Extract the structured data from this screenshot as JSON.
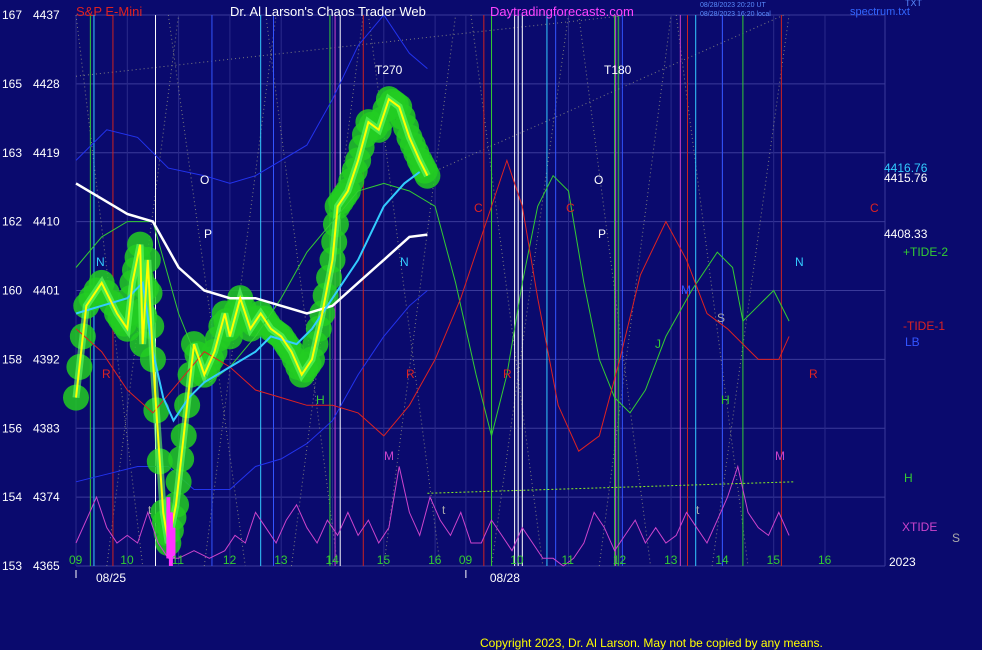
{
  "header": {
    "symbol": "S&P E-Mini",
    "title": "Dr. Al Larson's Chaos Trader Web",
    "site": "Daytradingforecasts.com",
    "stamp1": "08/28/2023 20:20 UT",
    "stamp2": "08/28/2023 16:20 local",
    "file": "spectrum.txt",
    "file_top": "TXT"
  },
  "copyright": "Copyright 2023, Dr. Al Larson. May not be copied by any means.",
  "colors": {
    "background": "#0a0a6e",
    "price_yellow": "#ffff00",
    "ma_cyan": "#33ccff",
    "ma_white": "#ffffff",
    "tide_green": "#33cc33",
    "tide_red": "#dd2222",
    "band_blue": "#2233ee",
    "xtide_magenta": "#cc44cc",
    "glow_green": "#22cc22"
  },
  "chart_data": {
    "type": "line",
    "y_axis": {
      "left_labels": [
        "167",
        "165",
        "163",
        "162",
        "160",
        "158",
        "156",
        "154",
        "153"
      ],
      "right_labels": [
        "4437",
        "4428",
        "4419",
        "4410",
        "4401",
        "4392",
        "4383",
        "4374",
        "4365"
      ],
      "range": [
        4365,
        4437
      ]
    },
    "x_axis": {
      "hour_labels_day1": [
        "09",
        "10",
        "11",
        "12",
        "13",
        "14",
        "15",
        "16"
      ],
      "hour_labels_day2": [
        "09",
        "10",
        "11",
        "12",
        "13",
        "14",
        "15",
        "16"
      ],
      "dates": [
        "08/25",
        "08/28"
      ],
      "year": "2023"
    },
    "right_legend": [
      {
        "text": "4416.76",
        "color": "#33ccff"
      },
      {
        "text": "4415.76",
        "color": "#ffffff"
      },
      {
        "text": "4408.33",
        "color": "#ffffff"
      },
      {
        "text": "+TIDE-2",
        "color": "#33cc33"
      },
      {
        "text": "-TIDE-1",
        "color": "#dd2222"
      },
      {
        "text": "LB",
        "color": "#3355ff"
      },
      {
        "text": "H",
        "color": "#33cc33"
      },
      {
        "text": "XTIDE",
        "color": "#cc44cc"
      },
      {
        "text": "S",
        "color": "#aaaaaa"
      }
    ],
    "annotations": [
      {
        "text": "T270",
        "color": "#ffffff"
      },
      {
        "text": "T180",
        "color": "#ffffff"
      },
      {
        "text": "O",
        "color": "#ffffff"
      },
      {
        "text": "P",
        "color": "#ffffff"
      },
      {
        "text": "O",
        "color": "#ffffff"
      },
      {
        "text": "P",
        "color": "#ffffff"
      },
      {
        "text": "R",
        "color": "#dd2222"
      },
      {
        "text": "R",
        "color": "#dd2222"
      },
      {
        "text": "R",
        "color": "#dd2222"
      },
      {
        "text": "R",
        "color": "#dd2222"
      },
      {
        "text": "C",
        "color": "#dd2222"
      },
      {
        "text": "C",
        "color": "#dd2222"
      },
      {
        "text": "C",
        "color": "#dd2222"
      },
      {
        "text": "N",
        "color": "#33ccff"
      },
      {
        "text": "N",
        "color": "#33ccff"
      },
      {
        "text": "N",
        "color": "#33ccff"
      },
      {
        "text": "H",
        "color": "#33cc33"
      },
      {
        "text": "H",
        "color": "#33cc33"
      },
      {
        "text": "M",
        "color": "#cc44cc"
      },
      {
        "text": "M",
        "color": "#cc44cc"
      },
      {
        "text": "S",
        "color": "#aaaaaa"
      },
      {
        "text": "J",
        "color": "#33cc33"
      },
      {
        "text": "M",
        "color": "#3355ff"
      },
      {
        "text": "t",
        "color": "#aaaaaa"
      },
      {
        "text": "t",
        "color": "#aaaaaa"
      },
      {
        "text": "t",
        "color": "#aaaaaa"
      }
    ],
    "series": [
      {
        "name": "Price",
        "color": "#ffff00",
        "points": [
          [
            9.0,
            4387
          ],
          [
            9.2,
            4399
          ],
          [
            9.5,
            4402
          ],
          [
            9.8,
            4398
          ],
          [
            10.0,
            4396
          ],
          [
            10.1,
            4402
          ],
          [
            10.25,
            4407
          ],
          [
            10.3,
            4394
          ],
          [
            10.4,
            4405
          ],
          [
            10.5,
            4392
          ],
          [
            10.7,
            4372
          ],
          [
            10.8,
            4368
          ],
          [
            10.95,
            4373
          ],
          [
            11.1,
            4382
          ],
          [
            11.3,
            4394
          ],
          [
            11.5,
            4390
          ],
          [
            11.7,
            4393
          ],
          [
            11.9,
            4398
          ],
          [
            12.0,
            4395
          ],
          [
            12.2,
            4400
          ],
          [
            12.4,
            4396
          ],
          [
            12.6,
            4398
          ],
          [
            12.8,
            4396
          ],
          [
            13.0,
            4395
          ],
          [
            13.2,
            4393
          ],
          [
            13.4,
            4390
          ],
          [
            13.6,
            4392
          ],
          [
            13.8,
            4398
          ],
          [
            14.0,
            4405
          ],
          [
            14.1,
            4412
          ],
          [
            14.3,
            4414
          ],
          [
            14.5,
            4418
          ],
          [
            14.7,
            4423
          ],
          [
            14.9,
            4422
          ],
          [
            15.1,
            4426
          ],
          [
            15.3,
            4425
          ],
          [
            15.5,
            4421
          ],
          [
            15.7,
            4418
          ],
          [
            15.85,
            4416
          ]
        ]
      },
      {
        "name": "Cyan MA",
        "color": "#33ccff",
        "points": [
          [
            9.0,
            4398
          ],
          [
            9.5,
            4399
          ],
          [
            10.0,
            4400
          ],
          [
            10.3,
            4402
          ],
          [
            10.5,
            4393
          ],
          [
            10.7,
            4387
          ],
          [
            10.9,
            4384
          ],
          [
            11.2,
            4387
          ],
          [
            11.5,
            4389
          ],
          [
            12.0,
            4391
          ],
          [
            12.5,
            4393
          ],
          [
            12.8,
            4395
          ],
          [
            13.3,
            4394
          ],
          [
            13.6,
            4396
          ],
          [
            14.0,
            4400
          ],
          [
            14.5,
            4405
          ],
          [
            15.0,
            4412
          ],
          [
            15.4,
            4415
          ],
          [
            15.7,
            4416.5
          ]
        ]
      },
      {
        "name": "White MA",
        "color": "#ffffff",
        "points": [
          [
            9.0,
            4415
          ],
          [
            9.5,
            4413
          ],
          [
            10.0,
            4411
          ],
          [
            10.5,
            4410
          ],
          [
            11.0,
            4404
          ],
          [
            11.5,
            4401
          ],
          [
            12.0,
            4400
          ],
          [
            12.5,
            4400
          ],
          [
            13.0,
            4399
          ],
          [
            13.5,
            4398
          ],
          [
            14.0,
            4399
          ],
          [
            14.5,
            4402
          ],
          [
            15.0,
            4405
          ],
          [
            15.5,
            4408
          ],
          [
            15.85,
            4408.3
          ]
        ]
      },
      {
        "name": "+TIDE-2",
        "color": "#33cc33",
        "points": [
          [
            9.0,
            4404
          ],
          [
            9.5,
            4408
          ],
          [
            10.0,
            4410
          ],
          [
            10.5,
            4410
          ],
          [
            11.0,
            4398
          ],
          [
            11.3,
            4393
          ],
          [
            11.6,
            4389
          ],
          [
            12.0,
            4391
          ],
          [
            12.5,
            4395
          ],
          [
            13.0,
            4400
          ],
          [
            13.5,
            4406
          ],
          [
            14.0,
            4410
          ],
          [
            14.5,
            4414
          ],
          [
            15.0,
            4415
          ],
          [
            15.5,
            4414
          ],
          [
            16.0,
            4412
          ],
          [
            16.4,
            4402
          ],
          [
            16.8,
            4390
          ],
          [
            17.1,
            4382
          ],
          [
            17.4,
            4390
          ],
          [
            17.7,
            4402
          ],
          [
            18.0,
            4412
          ],
          [
            18.3,
            4416
          ],
          [
            18.6,
            4414
          ],
          [
            18.9,
            4402
          ],
          [
            19.2,
            4392
          ],
          [
            19.5,
            4387
          ],
          [
            19.8,
            4385
          ],
          [
            20.1,
            4388
          ],
          [
            20.5,
            4395
          ],
          [
            21.0,
            4401
          ],
          [
            21.5,
            4406
          ],
          [
            21.8,
            4404
          ],
          [
            22.0,
            4397
          ],
          [
            22.3,
            4399
          ],
          [
            22.6,
            4401
          ],
          [
            22.9,
            4397
          ]
        ]
      },
      {
        "name": "-TIDE-1",
        "color": "#dd2222",
        "points": [
          [
            9.0,
            4396
          ],
          [
            9.5,
            4393
          ],
          [
            10.0,
            4388
          ],
          [
            10.5,
            4385
          ],
          [
            11.0,
            4389
          ],
          [
            11.5,
            4393
          ],
          [
            12.0,
            4391
          ],
          [
            12.5,
            4388
          ],
          [
            13.0,
            4387
          ],
          [
            13.5,
            4386
          ],
          [
            14.0,
            4386
          ],
          [
            14.5,
            4385
          ],
          [
            15.0,
            4382
          ],
          [
            15.5,
            4386
          ],
          [
            16.0,
            4392
          ],
          [
            16.5,
            4400
          ],
          [
            17.0,
            4410
          ],
          [
            17.4,
            4418
          ],
          [
            17.7,
            4412
          ],
          [
            18.0,
            4400
          ],
          [
            18.4,
            4386
          ],
          [
            18.8,
            4380
          ],
          [
            19.2,
            4382
          ],
          [
            19.6,
            4392
          ],
          [
            20.0,
            4403
          ],
          [
            20.5,
            4410
          ],
          [
            20.9,
            4405
          ],
          [
            21.3,
            4398
          ],
          [
            21.7,
            4396
          ],
          [
            22.0,
            4394
          ],
          [
            22.3,
            4392
          ],
          [
            22.7,
            4392
          ],
          [
            22.9,
            4395
          ]
        ]
      },
      {
        "name": "XTIDE",
        "color": "#cc44cc",
        "points": [
          [
            9.0,
            4368
          ],
          [
            9.2,
            4371
          ],
          [
            9.4,
            4374
          ],
          [
            9.6,
            4370
          ],
          [
            9.8,
            4368
          ],
          [
            10.0,
            4369
          ],
          [
            10.2,
            4368
          ],
          [
            10.4,
            4372
          ],
          [
            10.6,
            4368
          ],
          [
            10.8,
            4366
          ],
          [
            11.0,
            4366
          ],
          [
            11.3,
            4367
          ],
          [
            11.6,
            4366
          ],
          [
            11.9,
            4367
          ],
          [
            12.1,
            4369
          ],
          [
            12.3,
            4368
          ],
          [
            12.5,
            4372
          ],
          [
            12.7,
            4370
          ],
          [
            12.9,
            4368
          ],
          [
            13.1,
            4371
          ],
          [
            13.3,
            4373
          ],
          [
            13.5,
            4370
          ],
          [
            13.7,
            4368
          ],
          [
            13.9,
            4371
          ],
          [
            14.1,
            4369
          ],
          [
            14.3,
            4372
          ],
          [
            14.5,
            4369
          ],
          [
            14.7,
            4371
          ],
          [
            14.9,
            4368
          ],
          [
            15.1,
            4370
          ],
          [
            15.3,
            4378
          ],
          [
            15.5,
            4372
          ],
          [
            15.7,
            4369
          ],
          [
            15.9,
            4374
          ],
          [
            16.1,
            4371
          ],
          [
            16.3,
            4369
          ],
          [
            16.5,
            4372
          ],
          [
            16.7,
            4368
          ],
          [
            16.9,
            4368
          ],
          [
            17.1,
            4371
          ],
          [
            17.3,
            4369
          ],
          [
            17.5,
            4367
          ],
          [
            17.7,
            4370
          ],
          [
            17.9,
            4368
          ],
          [
            18.1,
            4366
          ],
          [
            18.3,
            4366
          ],
          [
            18.5,
            4365
          ],
          [
            18.7,
            4366
          ],
          [
            18.9,
            4368
          ],
          [
            19.1,
            4372
          ],
          [
            19.3,
            4370
          ],
          [
            19.5,
            4367
          ],
          [
            19.7,
            4369
          ],
          [
            19.9,
            4371
          ],
          [
            20.1,
            4368
          ],
          [
            20.3,
            4370
          ],
          [
            20.5,
            4368
          ],
          [
            20.7,
            4369
          ],
          [
            20.9,
            4372
          ],
          [
            21.1,
            4370
          ],
          [
            21.3,
            4368
          ],
          [
            21.5,
            4371
          ],
          [
            21.7,
            4374
          ],
          [
            21.9,
            4378
          ],
          [
            22.1,
            4372
          ],
          [
            22.3,
            4370
          ],
          [
            22.5,
            4369
          ],
          [
            22.7,
            4372
          ],
          [
            22.9,
            4369
          ]
        ]
      },
      {
        "name": "Upper band",
        "color": "#2233ee",
        "points": [
          [
            9.0,
            4418
          ],
          [
            9.6,
            4422
          ],
          [
            10.2,
            4421
          ],
          [
            10.8,
            4417
          ],
          [
            11.5,
            4416
          ],
          [
            12.0,
            4415
          ],
          [
            12.5,
            4416
          ],
          [
            13.0,
            4418
          ],
          [
            13.5,
            4420
          ],
          [
            14.0,
            4426
          ],
          [
            14.5,
            4433
          ],
          [
            15.0,
            4437
          ],
          [
            15.5,
            4432
          ],
          [
            15.85,
            4430
          ]
        ]
      },
      {
        "name": "Lower band",
        "color": "#2233ee",
        "points": [
          [
            9.0,
            4376
          ],
          [
            9.6,
            4377
          ],
          [
            10.2,
            4378
          ],
          [
            10.8,
            4378
          ],
          [
            11.3,
            4375
          ],
          [
            12.0,
            4375
          ],
          [
            12.5,
            4378
          ],
          [
            13.0,
            4379
          ],
          [
            13.5,
            4381
          ],
          [
            14.0,
            4384
          ],
          [
            14.5,
            4390
          ],
          [
            15.0,
            4395
          ],
          [
            15.5,
            4399
          ],
          [
            15.85,
            4401
          ]
        ]
      },
      {
        "name": "H line",
        "color": "#88ee22",
        "points": [
          [
            15.85,
            4374.5
          ],
          [
            23.0,
            4376
          ]
        ]
      }
    ],
    "vertical_lines": {
      "white": [
        10.55,
        14.15,
        17.55,
        17.62,
        17.7
      ],
      "red": [
        9.72,
        14.6,
        16.95,
        20.92,
        22.75
      ],
      "green": [
        9.28,
        13.95,
        17.1,
        19.5,
        19.57,
        22.0
      ],
      "cyan": [
        9.35,
        12.6,
        18.18,
        21.08
      ],
      "blue": [
        11.65,
        12.85,
        18.35,
        19.65,
        21.6
      ],
      "magenta": [
        14.05,
        19.52,
        20.78
      ]
    }
  }
}
